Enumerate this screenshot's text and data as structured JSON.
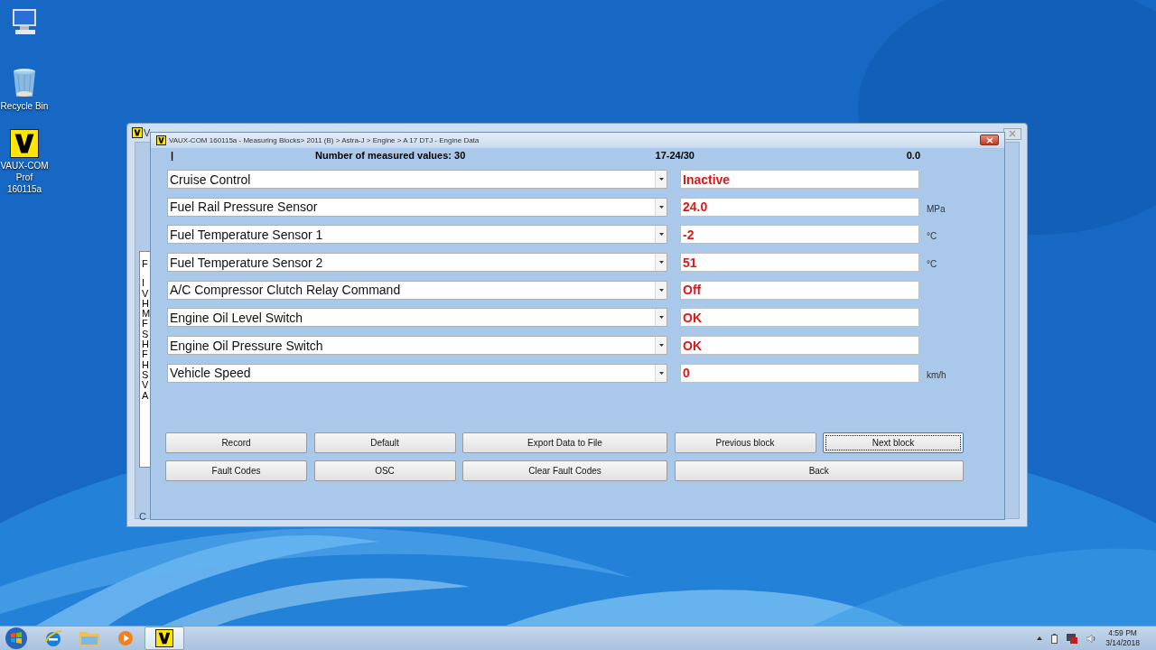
{
  "desktop_icons": [
    {
      "kind": "computer"
    },
    {
      "kind": "recycle_bin",
      "label": "Recycle Bin"
    },
    {
      "kind": "vaux",
      "label": "VAUX-COM Prof 160115a"
    }
  ],
  "back_window": {
    "title": "V",
    "list_lines": [
      "F",
      "I",
      "V",
      "H",
      "M",
      "F",
      "S",
      "H",
      "F",
      "H",
      "S",
      "V",
      "A"
    ],
    "footer": "C"
  },
  "main_window": {
    "title": "VAUX-COM 160115a - Measuring Blocks> 2011 (B) > Astra-J > Engine > A 17 DTJ - Engine Data",
    "header": {
      "marker": "|",
      "count": "Number of measured values: 30",
      "range": "17-24/30",
      "reading": "0.0"
    },
    "rows": [
      {
        "name": "Cruise Control",
        "value": "Inactive"
      },
      {
        "name": "Fuel Rail Pressure Sensor",
        "value": "24.0",
        "unit": "MPa"
      },
      {
        "name": "Fuel Temperature Sensor 1",
        "value": "-2",
        "unit": "°C"
      },
      {
        "name": "Fuel Temperature Sensor 2",
        "value": "51",
        "unit": "°C"
      },
      {
        "name": "A/C Compressor Clutch Relay Command",
        "value": "Off"
      },
      {
        "name": "Engine Oil Level Switch",
        "value": "OK"
      },
      {
        "name": "Engine Oil Pressure Switch",
        "value": "OK"
      },
      {
        "name": "Vehicle Speed",
        "value": "0",
        "unit": "km/h"
      }
    ],
    "button_rows": [
      [
        {
          "label": "Record",
          "focused": false
        },
        {
          "label": "Default",
          "focused": false
        },
        {
          "label": "Export Data to File",
          "focused": false
        },
        {
          "label": "Previous block",
          "focused": false
        },
        {
          "label": "Next block",
          "focused": true
        }
      ],
      [
        {
          "label": "Fault Codes",
          "focused": false
        },
        {
          "label": "OSC",
          "focused": false
        },
        {
          "label": "Clear Fault Codes",
          "focused": false
        },
        {
          "label": "Back",
          "focused": false
        }
      ]
    ]
  },
  "taskbar": {
    "apps": [
      {
        "kind": "ie",
        "selected": false
      },
      {
        "kind": "explorer",
        "selected": false
      },
      {
        "kind": "media",
        "selected": false
      },
      {
        "kind": "vaux",
        "selected": true
      }
    ],
    "tray": {
      "time": "4:59 PM",
      "date": "3/14/2018"
    }
  }
}
